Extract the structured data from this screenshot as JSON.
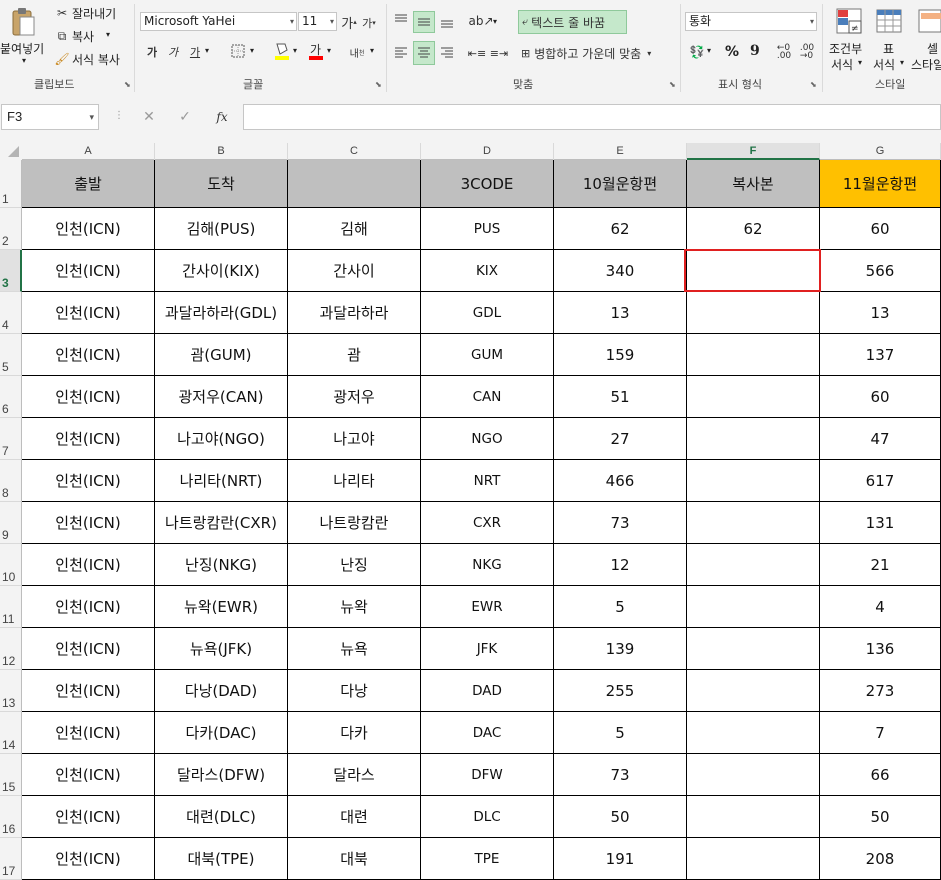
{
  "ribbon": {
    "clipboard": {
      "paste_label": "붙여넣기",
      "cut_label": "잘라내기",
      "copy_label": "복사",
      "format_painter_label": "서식 복사",
      "group_label": "클립보드"
    },
    "font": {
      "font_name": "Microsoft YaHei",
      "font_size": "11",
      "group_label": "글꼴"
    },
    "alignment": {
      "wrap_text_label": "텍스트 줄 바꿈",
      "merge_center_label": "병합하고 가운데 맞춤",
      "group_label": "맞춤"
    },
    "number": {
      "format_value": "통화",
      "percent_symbol": "%",
      "comma_symbol": "9",
      "group_label": "표시 형식"
    },
    "styles": {
      "conditional_label_1": "조건부",
      "conditional_label_2": "서식",
      "table_label_1": "표",
      "table_label_2": "서식",
      "cell_styles_label_1": "셀",
      "cell_styles_label_2": "스타일",
      "group_label": "스타일"
    }
  },
  "formula_bar": {
    "name_box": "F3",
    "formula": "",
    "fx_symbol": "fx"
  },
  "sheet": {
    "columns": [
      "A",
      "B",
      "C",
      "D",
      "E",
      "F",
      "G"
    ],
    "selected_column": "F",
    "selected_row": "3",
    "accent_color": "#ffc000",
    "header_color": "#bfbfbf",
    "header_row": [
      "출발",
      "도착",
      "",
      "3CODE",
      "10월운항편",
      "복사본",
      "11월운항편"
    ],
    "rows": [
      {
        "num": "2",
        "cells": [
          "인천(ICN)",
          "김해(PUS)",
          "김해",
          "PUS",
          "62",
          "62",
          "60"
        ]
      },
      {
        "num": "3",
        "cells": [
          "인천(ICN)",
          "간사이(KIX)",
          "간사이",
          "KIX",
          "340",
          "",
          "566"
        ]
      },
      {
        "num": "4",
        "cells": [
          "인천(ICN)",
          "과달라하라(GDL)",
          "과달라하라",
          "GDL",
          "13",
          "",
          "13"
        ]
      },
      {
        "num": "5",
        "cells": [
          "인천(ICN)",
          "괌(GUM)",
          "괌",
          "GUM",
          "159",
          "",
          "137"
        ]
      },
      {
        "num": "6",
        "cells": [
          "인천(ICN)",
          "광저우(CAN)",
          "광저우",
          "CAN",
          "51",
          "",
          "60"
        ]
      },
      {
        "num": "7",
        "cells": [
          "인천(ICN)",
          "나고야(NGO)",
          "나고야",
          "NGO",
          "27",
          "",
          "47"
        ]
      },
      {
        "num": "8",
        "cells": [
          "인천(ICN)",
          "나리타(NRT)",
          "나리타",
          "NRT",
          "466",
          "",
          "617"
        ]
      },
      {
        "num": "9",
        "cells": [
          "인천(ICN)",
          "나트랑캄란(CXR)",
          "나트랑캄란",
          "CXR",
          "73",
          "",
          "131"
        ]
      },
      {
        "num": "10",
        "cells": [
          "인천(ICN)",
          "난징(NKG)",
          "난징",
          "NKG",
          "12",
          "",
          "21"
        ]
      },
      {
        "num": "11",
        "cells": [
          "인천(ICN)",
          "뉴왁(EWR)",
          "뉴왁",
          "EWR",
          "5",
          "",
          "4"
        ]
      },
      {
        "num": "12",
        "cells": [
          "인천(ICN)",
          "뉴욕(JFK)",
          "뉴욕",
          "JFK",
          "139",
          "",
          "136"
        ]
      },
      {
        "num": "13",
        "cells": [
          "인천(ICN)",
          "다낭(DAD)",
          "다낭",
          "DAD",
          "255",
          "",
          "273"
        ]
      },
      {
        "num": "14",
        "cells": [
          "인천(ICN)",
          "다카(DAC)",
          "다카",
          "DAC",
          "5",
          "",
          "7"
        ]
      },
      {
        "num": "15",
        "cells": [
          "인천(ICN)",
          "달라스(DFW)",
          "달라스",
          "DFW",
          "73",
          "",
          "66"
        ]
      },
      {
        "num": "16",
        "cells": [
          "인천(ICN)",
          "대련(DLC)",
          "대련",
          "DLC",
          "50",
          "",
          "50"
        ]
      },
      {
        "num": "17",
        "cells": [
          "인천(ICN)",
          "대북(TPE)",
          "대북",
          "TPE",
          "191",
          "",
          "208"
        ]
      }
    ],
    "header_row_num": "1"
  }
}
